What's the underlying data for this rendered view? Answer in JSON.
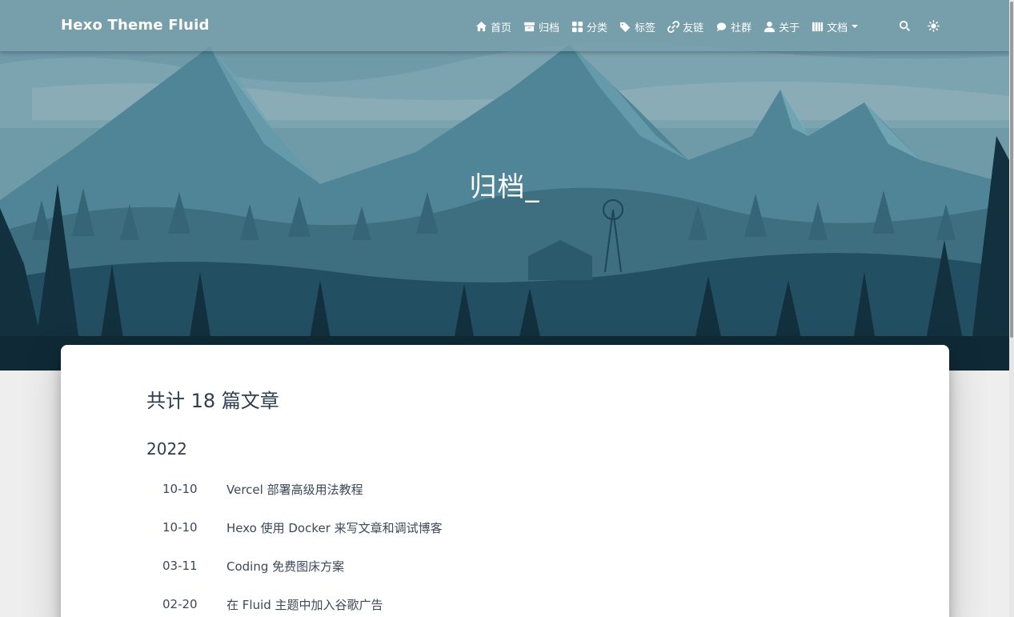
{
  "navbar": {
    "brand": "Hexo Theme Fluid",
    "items": [
      {
        "label": "首页",
        "icon": "home-icon"
      },
      {
        "label": "归档",
        "icon": "archive-icon"
      },
      {
        "label": "分类",
        "icon": "category-icon"
      },
      {
        "label": "标签",
        "icon": "tags-icon"
      },
      {
        "label": "友链",
        "icon": "link-icon"
      },
      {
        "label": "社群",
        "icon": "chat-icon"
      },
      {
        "label": "关于",
        "icon": "user-icon"
      },
      {
        "label": "文档",
        "icon": "book-icon"
      }
    ],
    "search_icon": "search-icon",
    "theme_icon": "sun-icon"
  },
  "banner": {
    "title": "归档_"
  },
  "archive": {
    "total": "共计 18 篇文章",
    "year": "2022",
    "posts": [
      {
        "date": "10-10",
        "title": "Vercel 部署高级用法教程"
      },
      {
        "date": "10-10",
        "title": "Hexo 使用 Docker 来写文章和调试博客"
      },
      {
        "date": "03-11",
        "title": "Coding 免费图床方案"
      },
      {
        "date": "02-20",
        "title": "在 Fluid 主题中加入谷歌广告"
      }
    ]
  },
  "colors": {
    "navbar": "#78a0ac",
    "page_background": "#eeeeee",
    "text": "#2c3e50"
  }
}
